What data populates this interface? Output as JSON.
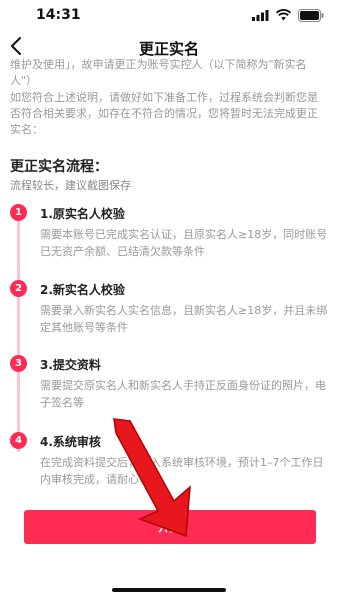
{
  "status_bar": {
    "time": "14:31"
  },
  "nav": {
    "title": "更正实名"
  },
  "intro": {
    "continuation": "维护及使用」，故申请更正为账号实控人（以下简称为\"新实名人\"）",
    "paragraph": "如您符合上述说明，请做好如下准备工作，过程系统会判断您是否符合相关要求，如存在不符合的情况，您将暂时无法完成更正实名："
  },
  "flow": {
    "title": "更正实名流程：",
    "subtitle": "流程较长，建议截图保存",
    "steps": [
      {
        "num": "1",
        "title": "1.原实名人校验",
        "desc": "需要本账号已完成实名认证，且原实名人≥18岁，同时账号已无资产余额、已结清欠款等条件"
      },
      {
        "num": "2",
        "title": "2.新实名人校验",
        "desc": "需要录入新实名人实名信息，且新实名人≥18岁，并且未绑定其他账号等条件"
      },
      {
        "num": "3",
        "title": "3.提交资料",
        "desc": "需要提交原实名人和新实名人手持正反面身份证的照片，电子签名等"
      },
      {
        "num": "4",
        "title": "4.系统审核",
        "desc": "在完成资料提交后，进入系统审核环境，预计1–7个工作日内审核完成，请耐心等待"
      }
    ]
  },
  "start_button": {
    "label": "开始"
  },
  "colors": {
    "accent": "#fe2c55",
    "timeline": "#f7c6ce",
    "muted_text": "#999999"
  },
  "icons": {
    "back": "chevron-left-icon",
    "signal": "signal-icon",
    "wifi": "wifi-icon",
    "battery": "battery-icon",
    "arrow": "red-arrow-icon"
  }
}
